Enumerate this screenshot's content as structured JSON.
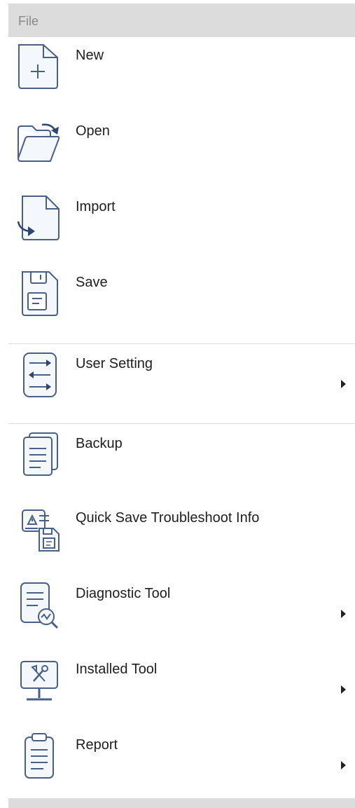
{
  "menu": {
    "header": "File",
    "items": [
      {
        "label": "New"
      },
      {
        "label": "Open"
      },
      {
        "label": "Import"
      },
      {
        "label": "Save"
      },
      {
        "label": "User Setting"
      },
      {
        "label": "Backup"
      },
      {
        "label": "Quick Save Troubleshoot Info"
      },
      {
        "label": "Diagnostic Tool"
      },
      {
        "label": "Installed Tool"
      },
      {
        "label": "Report"
      }
    ]
  },
  "icons": [
    "new-file-icon",
    "open-folder-icon",
    "import-icon",
    "save-icon",
    "settings-sliders-icon",
    "backup-icon",
    "troubleshoot-save-icon",
    "diagnostic-icon",
    "installed-tool-icon",
    "report-icon"
  ],
  "colors": {
    "icon_stroke": "#4a5f86",
    "icon_fill": "#f4f7fc",
    "header_bg": "#dcdcdc",
    "arrow_fill": "#2f4572"
  }
}
